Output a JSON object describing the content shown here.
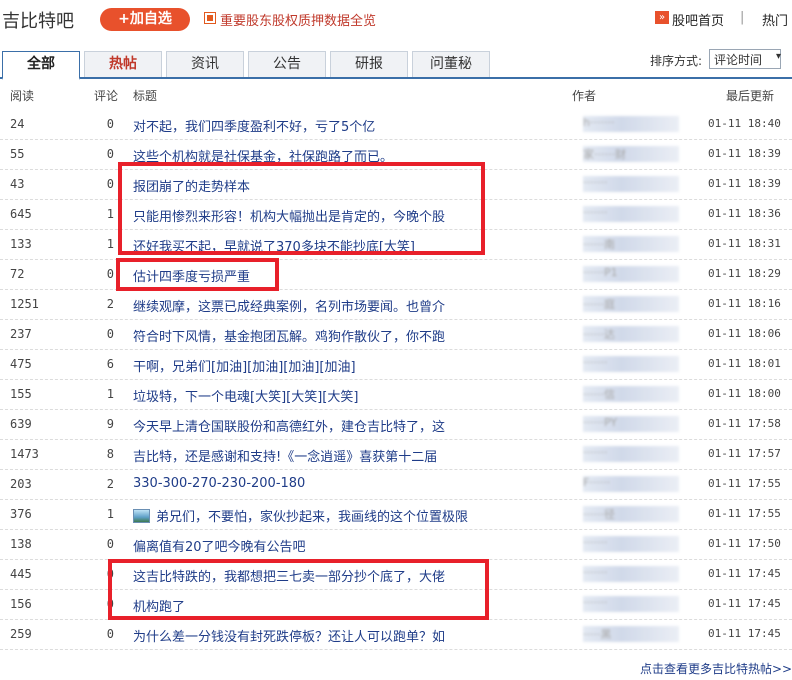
{
  "header": {
    "bar_title": "吉比特吧",
    "add_button": "+加自选",
    "promo_link": "重要股东股权质押数据全览",
    "home_icon": "»",
    "home_link": "股吧首页",
    "separator": "|",
    "hot_link": "热门"
  },
  "tabs": [
    {
      "label": "全部",
      "active": true
    },
    {
      "label": "热帖",
      "hot": true
    },
    {
      "label": "资讯"
    },
    {
      "label": "公告"
    },
    {
      "label": "研报"
    },
    {
      "label": "问董秘"
    }
  ],
  "sort": {
    "label": "排序方式:",
    "selected": "评论时间",
    "arrow": "▾"
  },
  "columns": {
    "read": "阅读",
    "comments": "评论",
    "title": "标题",
    "author": "作者",
    "updated": "最后更新"
  },
  "rows": [
    {
      "read": "24",
      "comments": "0",
      "title": "对不起，我们四季度盈利不好，亏了5个亿",
      "author": "h·······",
      "time": "01-11 18:40"
    },
    {
      "read": "55",
      "comments": "0",
      "title": "这些个机构就是社保基金，社保跑路了而已。",
      "author": "家······财",
      "time": "01-11 18:39"
    },
    {
      "read": "43",
      "comments": "0",
      "title": "报团崩了的走势样本",
      "author": "·······",
      "time": "01-11 18:39"
    },
    {
      "read": "645",
      "comments": "1",
      "title": "只能用惨烈来形容！机构大幅抛出是肯定的，今晚个股",
      "author": "·······",
      "time": "01-11 18:36"
    },
    {
      "read": "133",
      "comments": "1",
      "title": "还好我买不起，早就说了370多块不能抄底[大笑]",
      "author": "······南",
      "time": "01-11 18:31"
    },
    {
      "read": "72",
      "comments": "0",
      "title": "估计四季度亏损严重",
      "author": "······P1",
      "time": "01-11 18:29"
    },
    {
      "read": "1251",
      "comments": "2",
      "title": "继续观摩，这票已成经典案例，名列市场要闻。也曾介",
      "author": "······庭",
      "time": "01-11 18:16"
    },
    {
      "read": "237",
      "comments": "0",
      "title": "符合时下风情，基金抱团瓦解。鸡狗作散伙了，你不跑",
      "author": "······达",
      "time": "01-11 18:06"
    },
    {
      "read": "475",
      "comments": "6",
      "title": "干啊，兄弟们[加油][加油][加油][加油]",
      "author": "·······",
      "time": "01-11 18:01"
    },
    {
      "read": "155",
      "comments": "1",
      "title": "垃圾特，下一个电魂[大笑][大笑][大笑]",
      "author": "······信",
      "time": "01-11 18:00"
    },
    {
      "read": "639",
      "comments": "9",
      "title": "今天早上清仓国联股份和高德红外，建仓吉比特了，这",
      "author": "······PY",
      "time": "01-11 17:58"
    },
    {
      "read": "1473",
      "comments": "8",
      "title": "吉比特，还是感谢和支持!《一念逍遥》喜获第十二届",
      "author": "·······",
      "time": "01-11 17:57"
    },
    {
      "read": "203",
      "comments": "2",
      "title": "330-300-270-230-200-180",
      "author": "F······",
      "time": "01-11 17:55"
    },
    {
      "read": "376",
      "comments": "1",
      "title": "弟兄们，不要怕，家伙抄起来，我画线的这个位置极限",
      "author": "······径",
      "time": "01-11 17:55",
      "image": true
    },
    {
      "read": "138",
      "comments": "0",
      "title": "偏离值有20了吧今晚有公告吧",
      "author": "·······",
      "time": "01-11 17:50"
    },
    {
      "read": "445",
      "comments": "0",
      "title": "这吉比特跌的，我都想把三七卖一部分抄个底了，大佬",
      "author": "·······",
      "time": "01-11 17:45"
    },
    {
      "read": "156",
      "comments": "0",
      "title": "机构跑了",
      "author": "·······",
      "time": "01-11 17:45"
    },
    {
      "read": "259",
      "comments": "0",
      "title": "为什么差一分钱没有封死跌停板？还让人可以跑单？如",
      "author": "·····黑",
      "time": "01-11 17:45"
    }
  ],
  "footer": {
    "more_link": "点击查看更多吉比特热帖>>"
  },
  "colors": {
    "tab_border": "#3b6fa8",
    "link": "#1f3c88",
    "accent": "#e8512c",
    "highlight": "#e8202a"
  }
}
